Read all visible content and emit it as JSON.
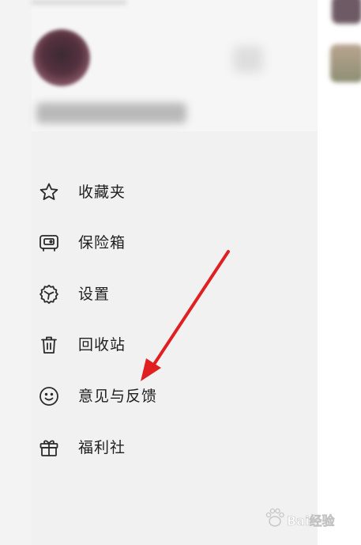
{
  "menu": {
    "items": [
      {
        "label": "收藏夹",
        "icon": "star-icon"
      },
      {
        "label": "保险箱",
        "icon": "safe-icon"
      },
      {
        "label": "设置",
        "icon": "settings-icon"
      },
      {
        "label": "回收站",
        "icon": "trash-icon"
      },
      {
        "label": "意见与反馈",
        "icon": "smiley-icon"
      },
      {
        "label": "福利社",
        "icon": "gift-icon"
      }
    ]
  },
  "watermark": {
    "brand_text": "Bai经验",
    "icon": "paw-icon"
  },
  "colors": {
    "drawer_background": "#f1f1f1",
    "text": "#1f1f1f",
    "icon_stroke": "#2a2a2a",
    "annotation_arrow": "#e02020"
  }
}
